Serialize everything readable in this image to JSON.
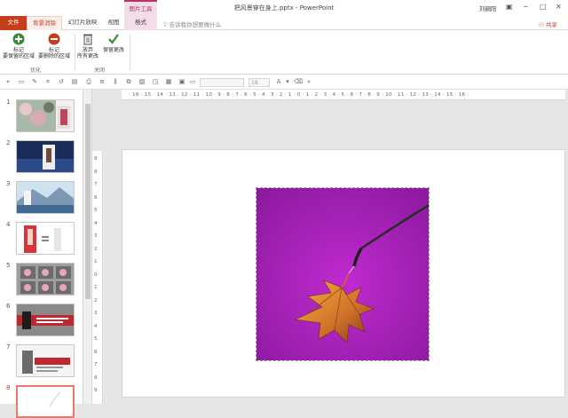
{
  "titlebar": {
    "context_tools": "图片工具",
    "document_title": "把风景穿在身上.pptx - PowerPoint",
    "user": "刘嗣阳",
    "restore_icon": "restore-icon",
    "minimize_icon": "minimize-icon",
    "maximize_icon": "maximize-icon",
    "close_icon": "close-icon"
  },
  "tabs": {
    "file": "文件",
    "backdrop": "背景消除",
    "slideshow": "幻灯片放映",
    "view": "视图",
    "format": "格式"
  },
  "tellme": {
    "icon": "lightbulb-icon",
    "text": "告诉我你想要做什么"
  },
  "share": {
    "icon": "person-icon",
    "text": "共享"
  },
  "ribbon": {
    "mark_keep": {
      "line1": "标记",
      "line2": "要保留的区域",
      "icon": "plus-circle-icon"
    },
    "mark_remove": {
      "line1": "标记",
      "line2": "要删除的区域",
      "icon": "minus-circle-icon"
    },
    "group_optimize": "优化",
    "discard": {
      "line1": "放弃",
      "line2": "所有更改",
      "icon": "trash-icon"
    },
    "keep": {
      "line1": "保留更改",
      "icon": "checkmark-icon"
    },
    "group_close": "关闭"
  },
  "quick_toolbar": {
    "font_size": "18"
  },
  "ruler": {
    "horizontal": "· 16 · 15 · 14 · 13 · 12 · 11 · 10 · 9 · 8 · 7 · 6 · 5 · 4 · 3 · 2 · 1 · 0 · 1 · 2 · 3 · 4 · 5 · 6 · 7 · 8 · 9 · 10 · 11 · 12 · 13 · 14 · 15 · 16 ·",
    "vertical": [
      "9",
      "8",
      "7",
      "6",
      "5",
      "4",
      "3",
      "2",
      "1",
      "0",
      "1",
      "2",
      "3",
      "4",
      "5",
      "6",
      "7",
      "8",
      "9"
    ]
  },
  "thumbnails": {
    "numbers": [
      "1",
      "2",
      "3",
      "4",
      "5",
      "6",
      "7",
      "8"
    ],
    "active_index": 8
  },
  "colors": {
    "accent": "#c43e1c",
    "context_tab": "#b8336a",
    "photo_bg": "#a31fb4"
  }
}
